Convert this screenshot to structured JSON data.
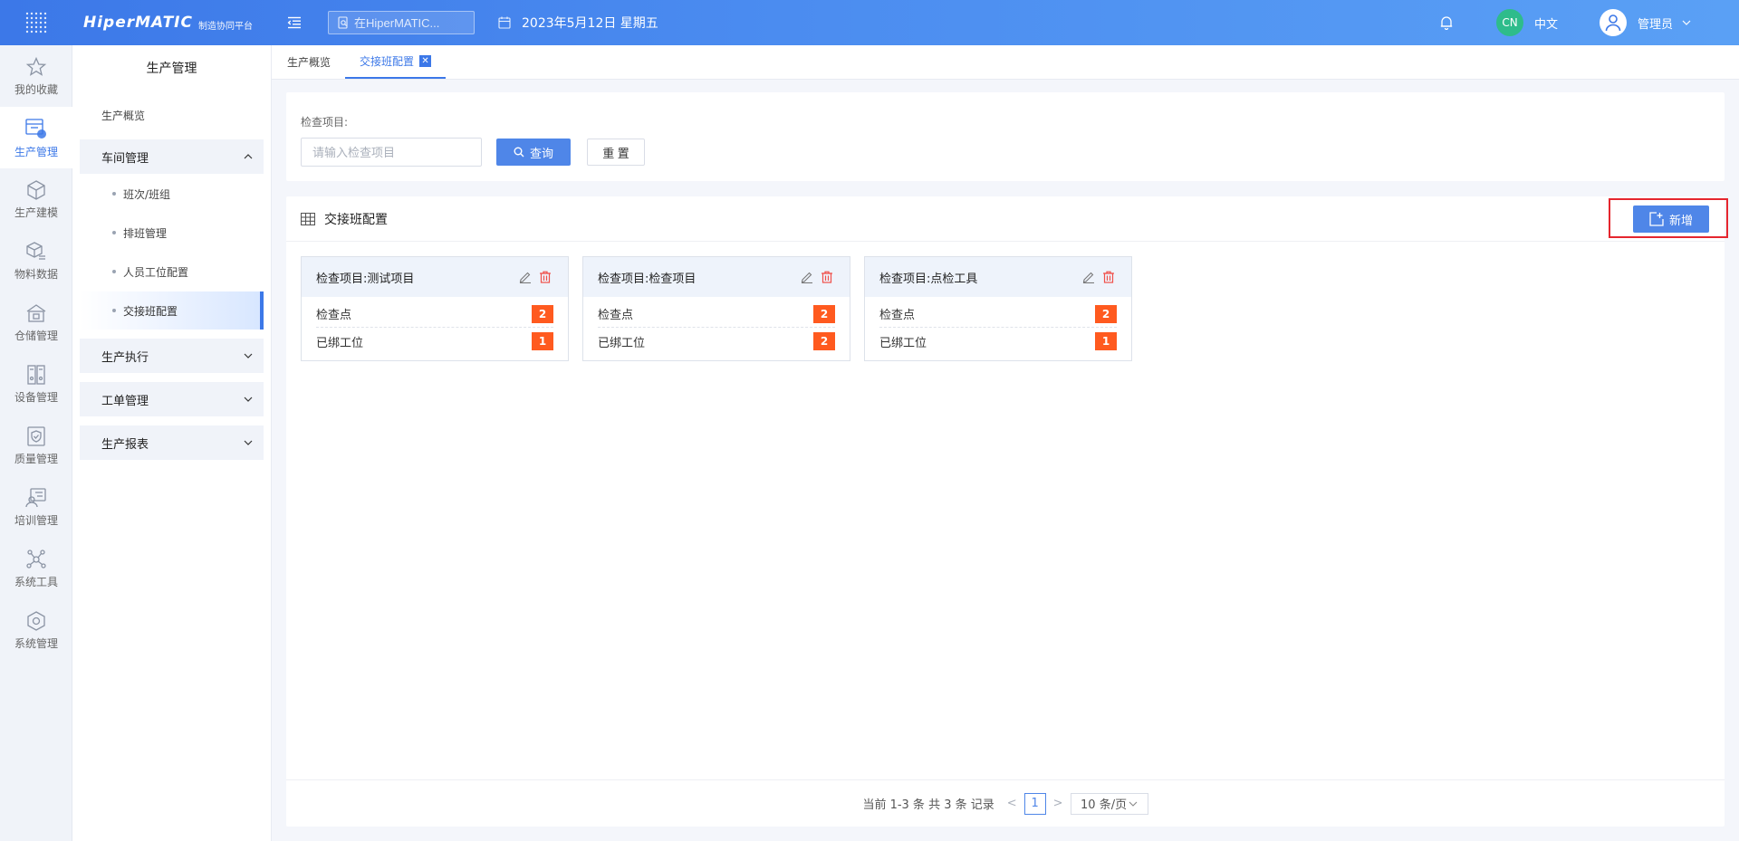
{
  "header": {
    "logo_main": "HiperMATIC",
    "logo_sub": "制造协同平台",
    "search_placeholder": "在HiperMATIC...",
    "date": "2023年5月12日 星期五",
    "lang_badge": "CN",
    "lang_label": "中文",
    "user_name": "管理员"
  },
  "rail": {
    "items": [
      {
        "label": "我的收藏",
        "icon": "star-icon"
      },
      {
        "label": "生产管理",
        "icon": "production-icon"
      },
      {
        "label": "生产建模",
        "icon": "cube-icon"
      },
      {
        "label": "物料数据",
        "icon": "material-icon"
      },
      {
        "label": "仓储管理",
        "icon": "warehouse-icon"
      },
      {
        "label": "设备管理",
        "icon": "device-icon"
      },
      {
        "label": "质量管理",
        "icon": "quality-icon"
      },
      {
        "label": "培训管理",
        "icon": "training-icon"
      },
      {
        "label": "系统工具",
        "icon": "tools-icon"
      },
      {
        "label": "系统管理",
        "icon": "settings-icon"
      }
    ],
    "active_index": 1
  },
  "sidebar": {
    "title": "生产管理",
    "overview": "生产概览",
    "group_workshop": "车间管理",
    "workshop_items": [
      "班次/班组",
      "排班管理",
      "人员工位配置",
      "交接班配置"
    ],
    "group_execution": "生产执行",
    "group_workorder": "工单管理",
    "group_report": "生产报表"
  },
  "tabs": {
    "tab1": "生产概览",
    "tab2": "交接班配置",
    "close_glyph": "✕"
  },
  "filter": {
    "label": "检查项目:",
    "placeholder": "请输入检查项目",
    "query_label": "查询",
    "reset_label": "重 置"
  },
  "panel": {
    "title": "交接班配置",
    "add_label": "新增"
  },
  "cards": [
    {
      "title": "检查项目:测试项目",
      "row1_label": "检查点",
      "row1_value": "2",
      "row2_label": "已绑工位",
      "row2_value": "1"
    },
    {
      "title": "检查项目:检查项目",
      "row1_label": "检查点",
      "row1_value": "2",
      "row2_label": "已绑工位",
      "row2_value": "2"
    },
    {
      "title": "检查项目:点检工具",
      "row1_label": "检查点",
      "row1_value": "2",
      "row2_label": "已绑工位",
      "row2_value": "1"
    }
  ],
  "pager": {
    "summary": "当前 1-3 条 共 3 条 记录",
    "prev": "<",
    "page": "1",
    "next": ">",
    "page_size": "10 条/页"
  },
  "colors": {
    "primary": "#4f86e8",
    "header_start": "#3c78e8",
    "badge": "#ff5a1f",
    "highlight_border": "#e5262e",
    "lang_badge": "#2ebc8b"
  }
}
